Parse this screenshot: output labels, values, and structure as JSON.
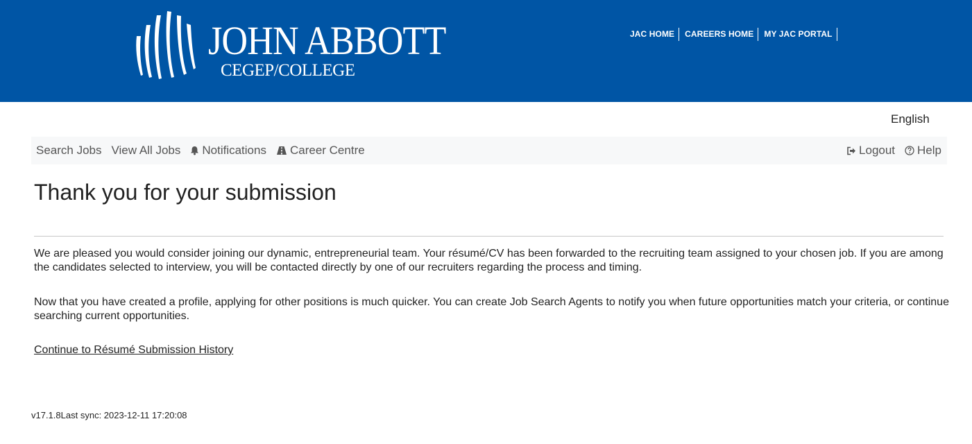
{
  "header": {
    "logo_name": "JOHN ABBOTT",
    "logo_sub": "CEGEP/COLLEGE",
    "links": [
      "JAC HOME",
      "CAREERS HOME",
      "MY JAC PORTAL"
    ],
    "banner_color": "#0055a5"
  },
  "language": "English",
  "nav": {
    "search_jobs": "Search Jobs",
    "view_all_jobs": "View All Jobs",
    "notifications": "Notifications",
    "career_centre": "Career Centre",
    "logout": "Logout",
    "help": "Help",
    "icons": {
      "notifications": "bell-icon",
      "career_centre": "road-icon",
      "logout": "sign-out-icon",
      "help": "question-circle-icon"
    }
  },
  "main": {
    "title": "Thank you for your submission",
    "paragraph1": "We are pleased you would consider joining our dynamic, entrepreneurial team. Your résumé/CV has been forwarded to the recruiting team assigned to your chosen job. If you are among the candidates selected to interview, you will be contacted directly by one of our recruiters regarding the process and timing.",
    "paragraph2": "Now that you have created a profile, applying for other positions is much quicker. You can create Job Search Agents to notify you when future opportunities match your criteria, or continue searching current opportunities.",
    "history_link": "Continue to Résumé Submission History"
  },
  "footer": {
    "version": "v17.1.8",
    "sync": "Last sync: 2023-12-11 17:20:08"
  }
}
